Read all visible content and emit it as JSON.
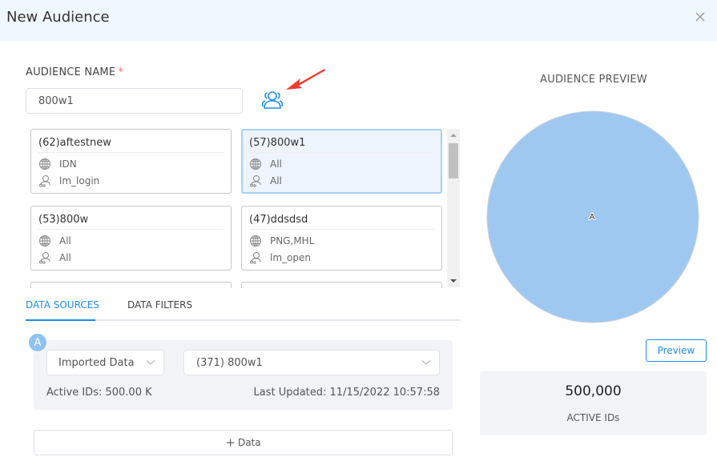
{
  "dialog": {
    "title": "New Audience",
    "close_icon": "close-icon"
  },
  "audience_name": {
    "label": "AUDIENCE NAME",
    "required_mark": "*",
    "value": "800w1",
    "users_icon": "users-icon",
    "annotation": "red-arrow-pointing-to-users-icon"
  },
  "audience_cards": [
    {
      "title": "(62)aftestnew",
      "region": "IDN",
      "event": "lm_login",
      "selected": false
    },
    {
      "title": "(57)800w1",
      "region": "All",
      "event": "All",
      "selected": true
    },
    {
      "title": "(53)800w",
      "region": "All",
      "event": "All",
      "selected": false
    },
    {
      "title": "(47)ddsdsd",
      "region": "PNG,MHL",
      "event": "lm_open",
      "selected": false
    }
  ],
  "tabs": [
    {
      "label": "DATA SOURCES",
      "active": true
    },
    {
      "label": "DATA FILTERS",
      "active": false
    }
  ],
  "data_source": {
    "badge": "A",
    "type_select": "Imported Data",
    "data_select": "(371) 800w1",
    "active_ids": "Active IDs: 500.00 K",
    "last_updated": "Last Updated: 11/15/2022 10:57:58"
  },
  "add_data": {
    "plus": "+",
    "label": "Data"
  },
  "preview": {
    "title": "AUDIENCE PREVIEW",
    "venn_label": "A",
    "venn_color": "#9fc8f0",
    "button": "Preview",
    "count": "500,000",
    "count_label": "ACTIVE IDs"
  },
  "colors": {
    "accent": "#1f8ceb",
    "header_bg": "#f0f8ff",
    "required": "#f56c6c",
    "annotation_arrow": "#f03a2e"
  }
}
